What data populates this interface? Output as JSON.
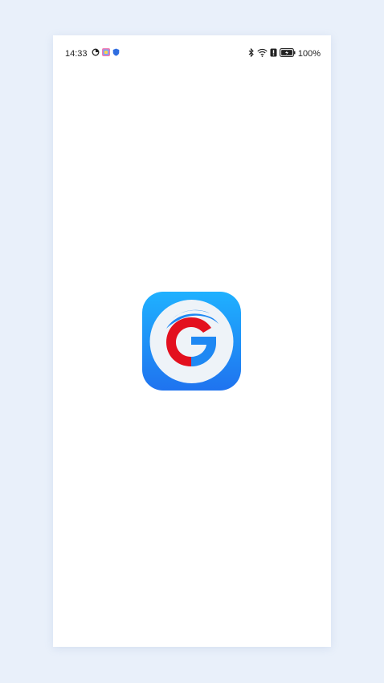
{
  "status_bar": {
    "time": "14:33",
    "battery_percent": "100%",
    "left_icons": [
      "sync-icon",
      "gallery-app-icon",
      "shield-icon"
    ],
    "right_icons": [
      "bluetooth-icon",
      "wifi-icon",
      "notification-badge-icon",
      "battery-icon"
    ]
  },
  "splash": {
    "logo_icon": "app-logo-g-icon",
    "colors": {
      "background_top": "#1fb1ff",
      "background_bottom": "#1f73ef",
      "ring": "#eef3f8",
      "letter_red": "#e3101e",
      "letter_blue": "#1e88f3"
    }
  }
}
